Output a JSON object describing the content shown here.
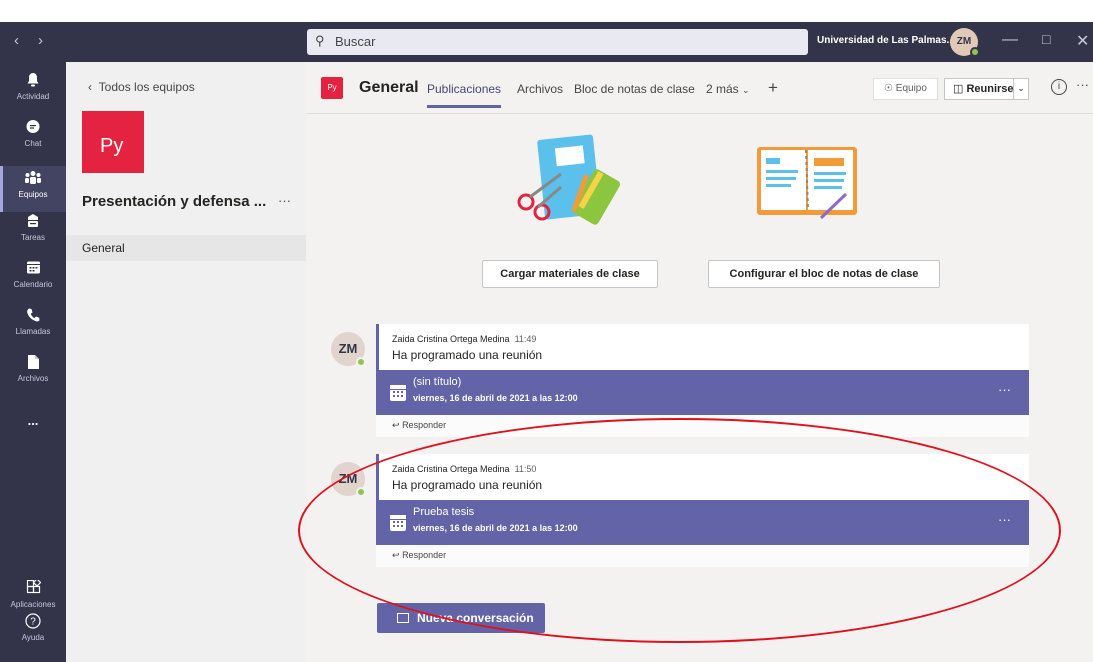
{
  "titlebar": {
    "search_placeholder": "Buscar",
    "org_name": "Universidad de Las Palmas...",
    "user_initials": "ZM",
    "window_controls": [
      "minimize-icon",
      "maximize-icon",
      "close-icon"
    ]
  },
  "rail": {
    "items": [
      {
        "label": "Actividad",
        "icon": "bell-icon"
      },
      {
        "label": "Chat",
        "icon": "chat-icon"
      },
      {
        "label": "Equipos",
        "icon": "teams-icon",
        "active": true
      },
      {
        "label": "Tareas",
        "icon": "assignments-icon"
      },
      {
        "label": "Calendario",
        "icon": "calendar-icon"
      },
      {
        "label": "Llamadas",
        "icon": "phone-icon"
      },
      {
        "label": "Archivos",
        "icon": "file-icon"
      }
    ],
    "more": "...",
    "apps_label": "Aplicaciones",
    "help_label": "Ayuda"
  },
  "sidebar": {
    "back_label": "Todos los equipos",
    "team_initials": "Py",
    "team_name": "Presentación y defensa ...",
    "more": "···",
    "channels": [
      "General"
    ]
  },
  "channel": {
    "initials": "Py",
    "title": "General",
    "tabs": [
      "Publicaciones",
      "Archivos",
      "Bloc de notas de clase",
      "2 más"
    ],
    "team_button": "Equipo",
    "meet_button": "Reunirse",
    "info": "i",
    "more": "···"
  },
  "actions": {
    "upload_label": "Cargar materiales de clase",
    "notebook_label": "Configurar el bloc de notas de clase"
  },
  "posts": [
    {
      "initials": "ZM",
      "author": "Zaida Cristina Ortega Medina",
      "time": "11:49",
      "text": "Ha programado una reunión",
      "meeting_title": "(sin título)",
      "meeting_date": "viernes, 16 de abril de 2021 a las 12:00",
      "reply_label": "Responder",
      "more": "···"
    },
    {
      "initials": "ZM",
      "author": "Zaida Cristina Ortega Medina",
      "time": "11:50",
      "text": "Ha programado una reunión",
      "meeting_title": "Prueba tesis",
      "meeting_date": "viernes, 16 de abril de 2021 a las 12:00",
      "reply_label": "Responder",
      "more": "···"
    }
  ],
  "new_conversation_label": "Nueva conversación",
  "colors": {
    "titlebar": "#33344a",
    "accent": "#6264a7",
    "team_tile": "#e3233f",
    "annotation": "#e0101d",
    "presence": "#92c353"
  }
}
